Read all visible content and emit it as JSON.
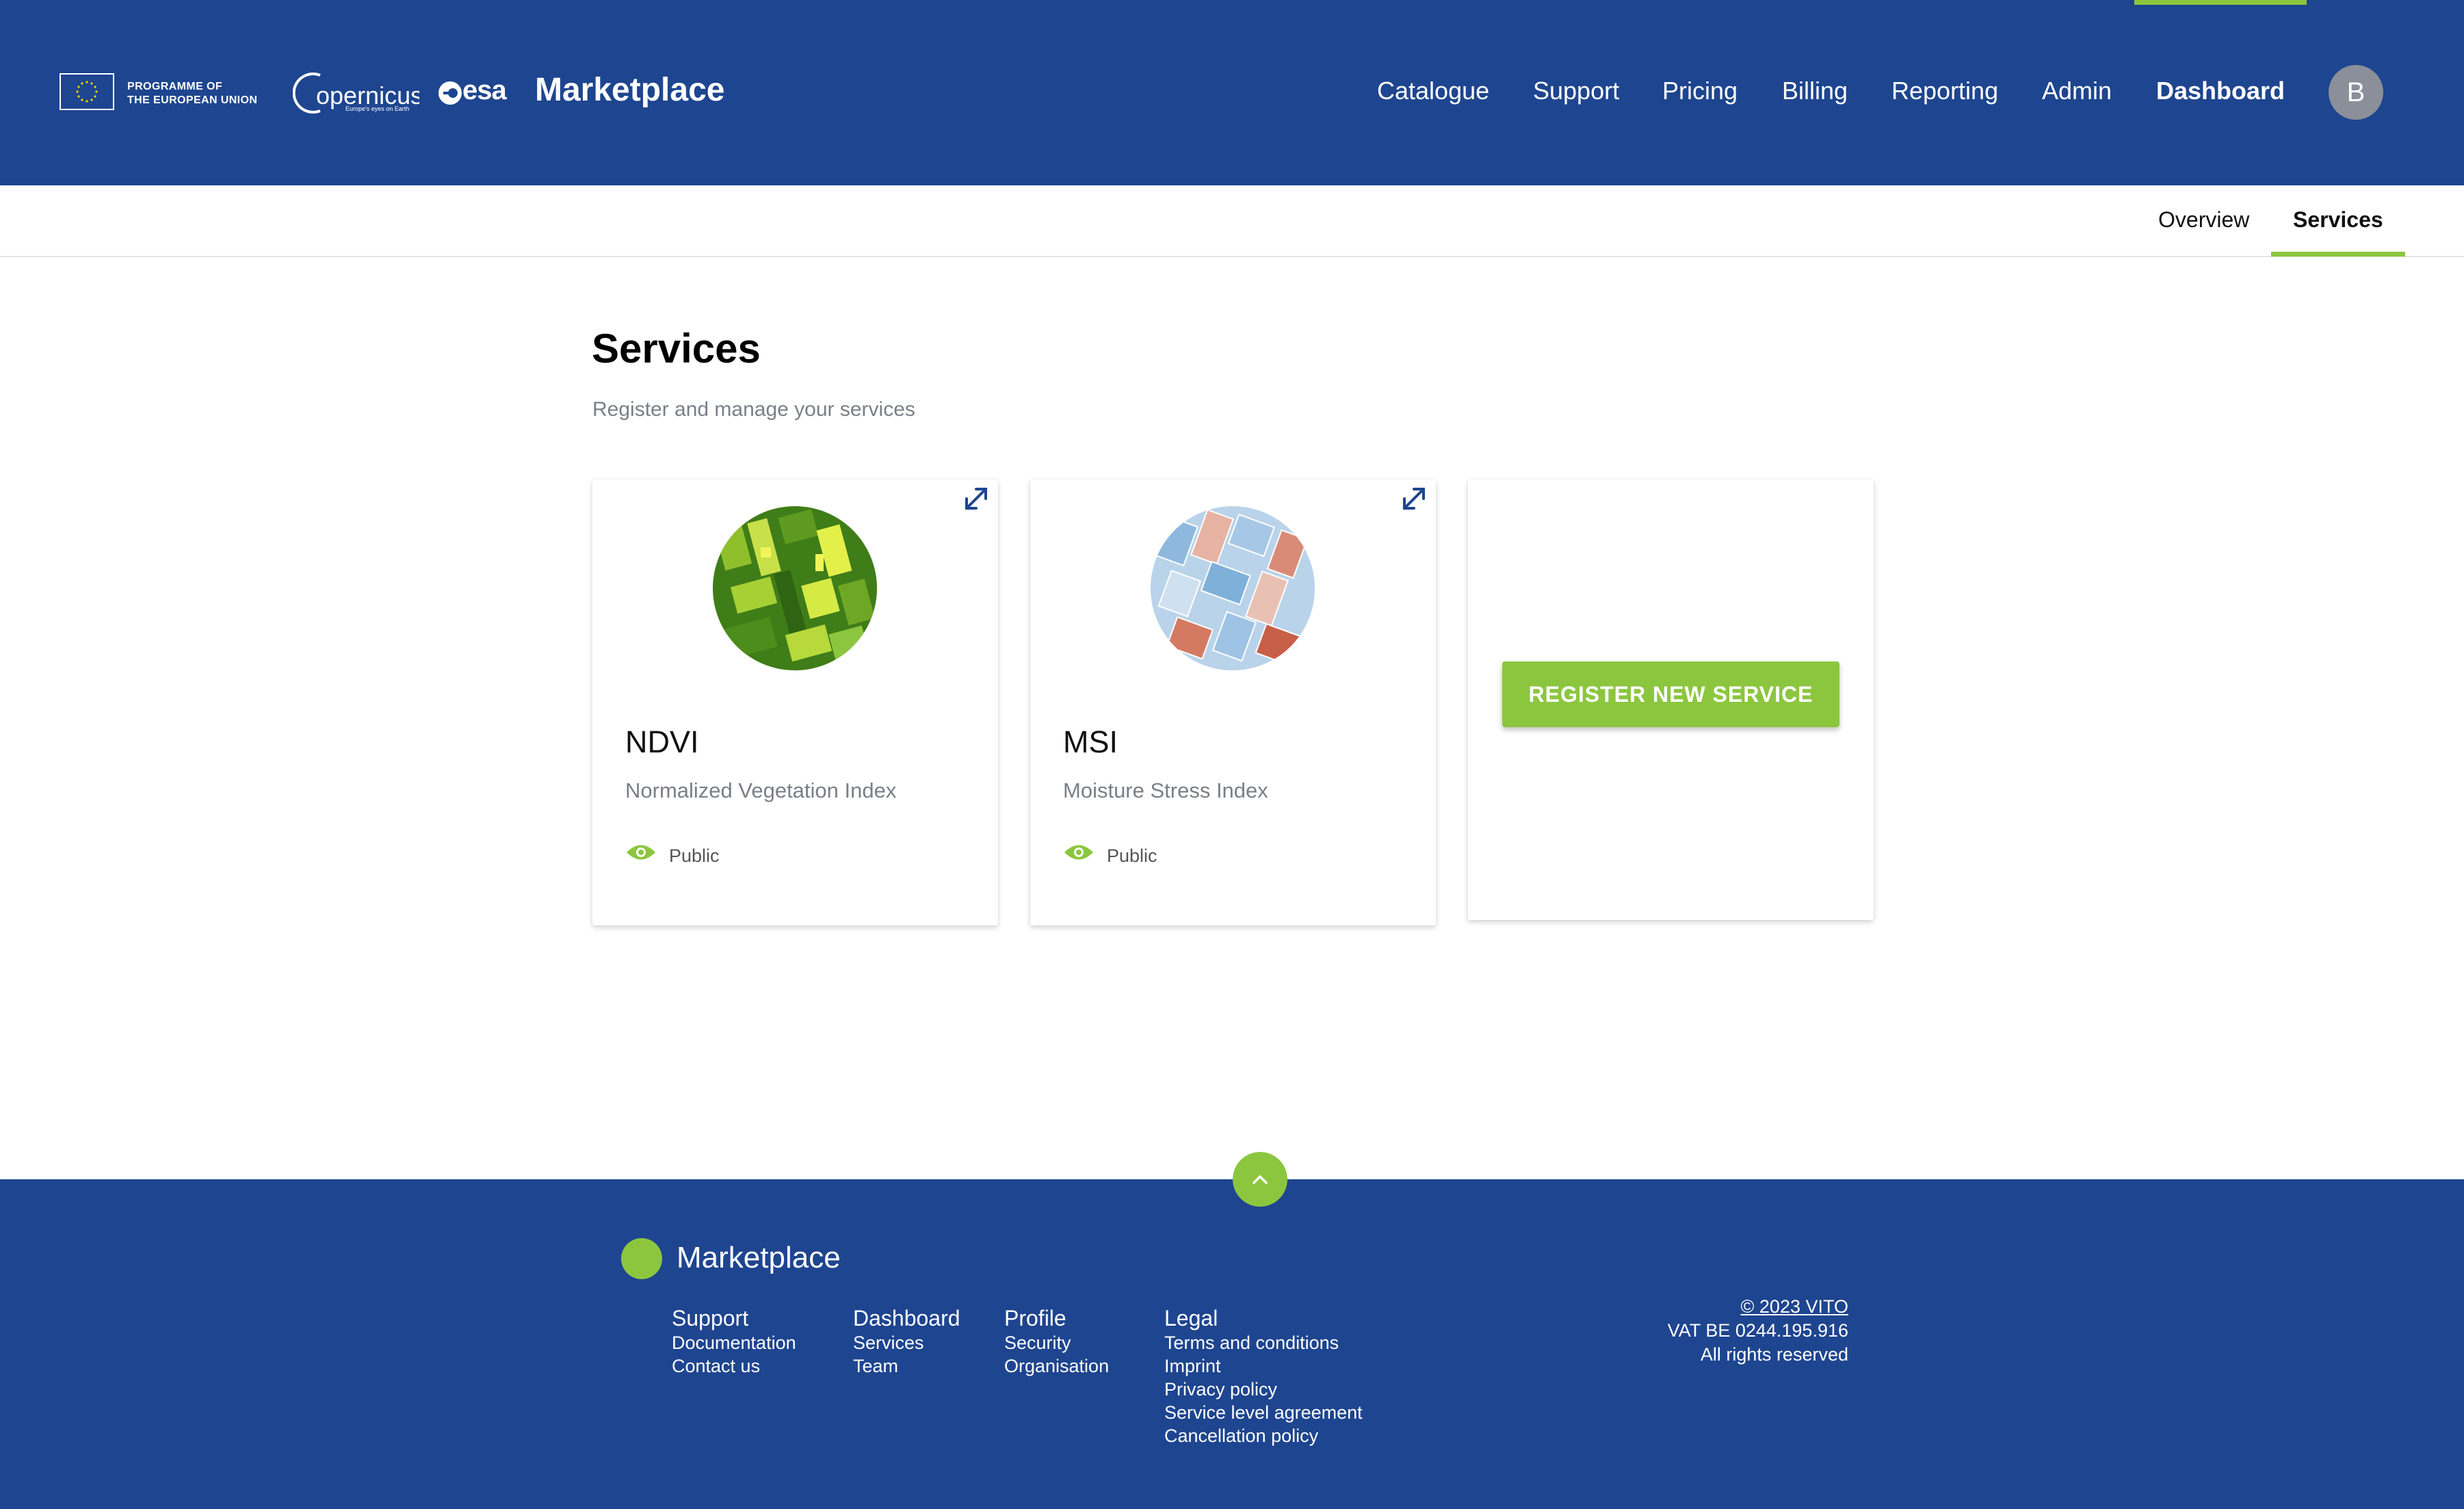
{
  "header": {
    "eu_text_line1": "PROGRAMME OF",
    "eu_text_line2": "THE EUROPEAN UNION",
    "copernicus_name": "opernicus",
    "copernicus_tagline": "Europe's eyes on Earth",
    "esa_name": "esa",
    "brand": "Marketplace",
    "nav": [
      "Catalogue",
      "Support",
      "Pricing",
      "Billing",
      "Reporting",
      "Admin",
      "Dashboard"
    ],
    "active_nav": "Dashboard",
    "avatar_initial": "B",
    "accent_color": "#8cc63f",
    "brand_color": "#1e458f"
  },
  "subnav": {
    "items": [
      "Overview",
      "Services"
    ],
    "active": "Services"
  },
  "main": {
    "title": "Services",
    "subtitle": "Register and manage your services",
    "services": [
      {
        "name": "NDVI",
        "description": "Normalized Vegetation Index",
        "visibility": "Public",
        "icon": "eye-icon"
      },
      {
        "name": "MSI",
        "description": "Moisture Stress Index",
        "visibility": "Public",
        "icon": "eye-icon"
      }
    ],
    "register_button": "REGISTER NEW SERVICE"
  },
  "footer": {
    "brand": "Marketplace",
    "columns": [
      {
        "heading": "Support",
        "links": [
          "Documentation",
          "Contact us"
        ]
      },
      {
        "heading": "Dashboard",
        "links": [
          "Services",
          "Team"
        ]
      },
      {
        "heading": "Profile",
        "links": [
          "Security",
          "Organisation"
        ]
      },
      {
        "heading": "Legal",
        "links": [
          "Terms and conditions",
          "Imprint",
          "Privacy policy",
          "Service level agreement",
          "Cancellation policy"
        ]
      }
    ],
    "copyright": "© 2023 VITO",
    "vat": "VAT BE 0244.195.916",
    "rights": "All rights reserved"
  }
}
